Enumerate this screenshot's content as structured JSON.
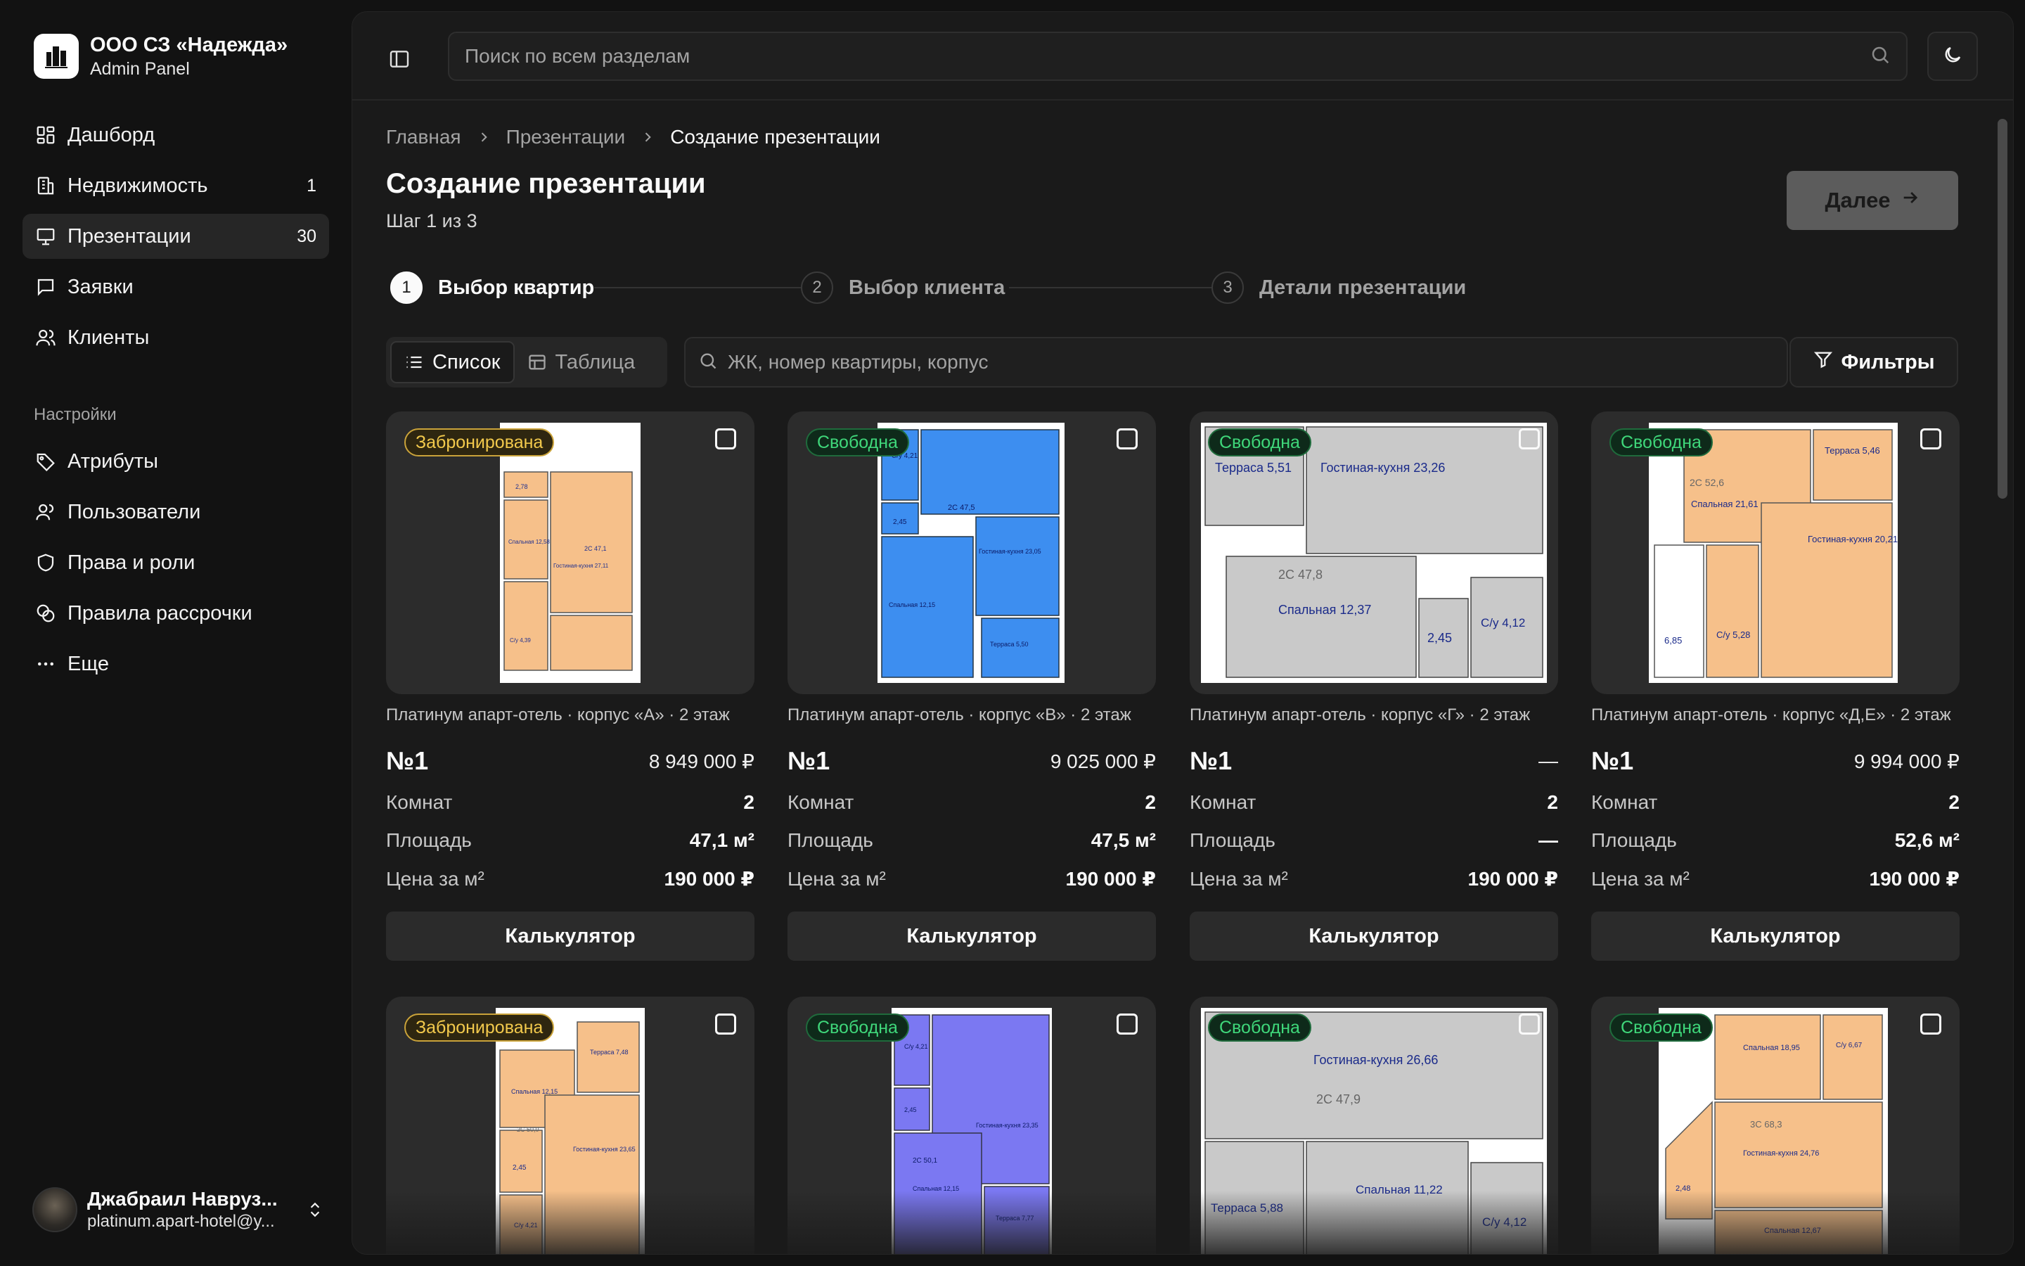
{
  "brand": {
    "name": "ООО СЗ «Надежда»",
    "subtitle": "Admin Panel",
    "logo_icon": "building-logo-icon"
  },
  "sidebar": {
    "items": [
      {
        "label": "Дашборд",
        "icon": "dashboard-icon",
        "count": ""
      },
      {
        "label": "Недвижимость",
        "icon": "building-icon",
        "count": "1"
      },
      {
        "label": "Презентации",
        "icon": "presentation-icon",
        "count": "30",
        "active": true
      },
      {
        "label": "Заявки",
        "icon": "message-icon",
        "count": ""
      },
      {
        "label": "Клиенты",
        "icon": "users-icon",
        "count": ""
      }
    ],
    "settings_label": "Настройки",
    "settings_items": [
      {
        "label": "Атрибуты",
        "icon": "tag-icon"
      },
      {
        "label": "Пользователи",
        "icon": "user-icon"
      },
      {
        "label": "Права и роли",
        "icon": "shield-icon"
      },
      {
        "label": "Правила рассрочки",
        "icon": "coins-icon"
      },
      {
        "label": "Еще",
        "icon": "more-icon"
      }
    ]
  },
  "user": {
    "name": "Джабраил Навруз...",
    "email": "platinum.apart-hotel@y..."
  },
  "topbar": {
    "search_placeholder": "Поиск по всем разделам"
  },
  "breadcrumb": [
    "Главная",
    "Презентации",
    "Создание презентации"
  ],
  "page": {
    "title": "Создание презентации",
    "step_text": "Шаг 1 из 3",
    "next_label": "Далее"
  },
  "stepper": [
    {
      "num": "1",
      "label": "Выбор квартир",
      "active": true
    },
    {
      "num": "2",
      "label": "Выбор клиента",
      "active": false
    },
    {
      "num": "3",
      "label": "Детали презентации",
      "active": false
    }
  ],
  "toolbar": {
    "view_list": "Список",
    "view_table": "Таблица",
    "search_placeholder": "ЖК, номер квартиры, корпус",
    "filters_label": "Фильтры"
  },
  "labels": {
    "rooms": "Комнат",
    "area": "Площадь",
    "price_per_m2": "Цена за м²",
    "calculator": "Калькулятор"
  },
  "cards": [
    {
      "status": "Забронирована",
      "status_type": "reserved",
      "meta": "Платинум апарт-отель · корпус «А» · 2 этаж",
      "number": "№1",
      "price": "8 949 000 ₽",
      "rooms": "2",
      "area": "47,1 м²",
      "price_m2": "190 000 ₽",
      "plan_color": "#f6c08a"
    },
    {
      "status": "Свободна",
      "status_type": "free",
      "meta": "Платинум апарт-отель · корпус «В» · 2 этаж",
      "number": "№1",
      "price": "9 025 000 ₽",
      "rooms": "2",
      "area": "47,5 м²",
      "price_m2": "190 000 ₽",
      "plan_color": "#3d8ef0"
    },
    {
      "status": "Свободна",
      "status_type": "free",
      "meta": "Платинум апарт-отель · корпус «Г» · 2 этаж",
      "number": "№1",
      "price": "—",
      "rooms": "2",
      "area": "—",
      "price_m2": "190 000 ₽",
      "plan_color": "#c9c9c9"
    },
    {
      "status": "Свободна",
      "status_type": "free",
      "meta": "Платинум апарт-отель · корпус «Д,Е» · 2 этаж",
      "number": "№1",
      "price": "9 994 000 ₽",
      "rooms": "2",
      "area": "52,6 м²",
      "price_m2": "190 000 ₽",
      "plan_color": "#f6c08a"
    },
    {
      "status": "Забронирована",
      "status_type": "reserved",
      "plan_color": "#f6c08a"
    },
    {
      "status": "Свободна",
      "status_type": "free",
      "plan_color": "#7b78f2"
    },
    {
      "status": "Свободна",
      "status_type": "free",
      "plan_color": "#c9c9c9"
    },
    {
      "status": "Свободна",
      "status_type": "free",
      "plan_color": "#f6c08a"
    }
  ],
  "plan_labels": {
    "c0": [
      "2,78",
      "Спальная 12,58",
      "2С 47,1",
      "Гостиная-кухня 27,11",
      "С/у 4,39"
    ],
    "c1": [
      "С/у 4,21",
      "2,45",
      "2С 47,5",
      "Гостиная-кухня 23,05",
      "Спальная 12,15",
      "Терраса 5,50"
    ],
    "c2": [
      "Терраса 5,51",
      "Гостиная-кухня 23,26",
      "2С 47,8",
      "Спальная 12,37",
      "2,45",
      "С/у 4,12"
    ],
    "c3": [
      "2С 52,6",
      "Терраса 5,46",
      "Спальная 21,61",
      "Гостиная-кухня 20,21",
      "6,85",
      "С/у 5,28"
    ],
    "c4": [
      "Терраса 7,48",
      "Спальная 12,15",
      "2С 50,0",
      "Гостиная-кухня 23,65",
      "2,45",
      "С/у 4,21"
    ],
    "c5": [
      "С/у 4,21",
      "2,45",
      "Гостиная-кухня 23,35",
      "2С 50,1",
      "Спальная 12,15",
      "Терраса 7,77"
    ],
    "c6": [
      "Гостиная-кухня 26,66",
      "2С 47,9",
      "Терраса 5,88",
      "Спальная 11,22",
      "С/у 4,12"
    ],
    "c7": [
      "Спальная 18,95",
      "С/у 6,67",
      "3С 68,3",
      "Гостиная-кухня 24,76",
      "2,48",
      "Спальная 12,67"
    ]
  }
}
